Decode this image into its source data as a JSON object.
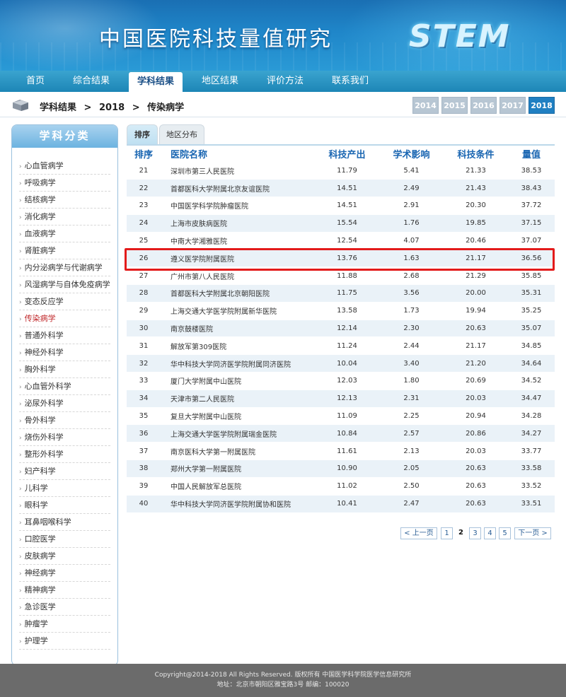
{
  "header": {
    "site_title": "中国医院科技量值研究",
    "logo_text": "STEM"
  },
  "nav": [
    {
      "label": "首页"
    },
    {
      "label": "综合结果"
    },
    {
      "label": "学科结果",
      "active": true
    },
    {
      "label": "地区结果"
    },
    {
      "label": "评价方法"
    },
    {
      "label": "联系我们"
    }
  ],
  "breadcrumb": [
    "学科结果",
    ">",
    "2018",
    ">",
    "传染病学"
  ],
  "years": [
    {
      "label": "2014"
    },
    {
      "label": "2015"
    },
    {
      "label": "2016"
    },
    {
      "label": "2017"
    },
    {
      "label": "2018",
      "active": true
    }
  ],
  "sidebar": {
    "title": "学科分类",
    "items": [
      "心血管病学",
      "呼吸病学",
      "结核病学",
      "消化病学",
      "血液病学",
      "肾脏病学",
      "内分泌病学与代谢病学",
      "风湿病学与自体免疫病学",
      "变态反应学",
      "传染病学",
      "普通外科学",
      "神经外科学",
      "胸外科学",
      "心血管外科学",
      "泌尿外科学",
      "骨外科学",
      "烧伤外科学",
      "整形外科学",
      "妇产科学",
      "儿科学",
      "眼科学",
      "耳鼻咽喉科学",
      "口腔医学",
      "皮肤病学",
      "神经病学",
      "精神病学",
      "急诊医学",
      "肿瘤学",
      "护理学"
    ],
    "active_index": 9
  },
  "tabs": [
    {
      "label": "排序",
      "active": true
    },
    {
      "label": "地区分布"
    }
  ],
  "table": {
    "headers": [
      "排序",
      "医院名称",
      "科技产出",
      "学术影响",
      "科技条件",
      "量值"
    ],
    "rows": [
      [
        "21",
        "深圳市第三人民医院",
        "11.79",
        "5.41",
        "21.33",
        "38.53"
      ],
      [
        "22",
        "首都医科大学附属北京友谊医院",
        "14.51",
        "2.49",
        "21.43",
        "38.43"
      ],
      [
        "23",
        "中国医学科学院肿瘤医院",
        "14.51",
        "2.91",
        "20.30",
        "37.72"
      ],
      [
        "24",
        "上海市皮肤病医院",
        "15.54",
        "1.76",
        "19.85",
        "37.15"
      ],
      [
        "25",
        "中南大学湘雅医院",
        "12.54",
        "4.07",
        "20.46",
        "37.07"
      ],
      [
        "26",
        "遵义医学院附属医院",
        "13.76",
        "1.63",
        "21.17",
        "36.56"
      ],
      [
        "27",
        "广州市第八人民医院",
        "11.88",
        "2.68",
        "21.29",
        "35.85"
      ],
      [
        "28",
        "首都医科大学附属北京朝阳医院",
        "11.75",
        "3.56",
        "20.00",
        "35.31"
      ],
      [
        "29",
        "上海交通大学医学院附属新华医院",
        "13.58",
        "1.73",
        "19.94",
        "35.25"
      ],
      [
        "30",
        "南京鼓楼医院",
        "12.14",
        "2.30",
        "20.63",
        "35.07"
      ],
      [
        "31",
        "解放军第309医院",
        "11.24",
        "2.44",
        "21.17",
        "34.85"
      ],
      [
        "32",
        "华中科技大学同济医学院附属同济医院",
        "10.04",
        "3.40",
        "21.20",
        "34.64"
      ],
      [
        "33",
        "厦门大学附属中山医院",
        "12.03",
        "1.80",
        "20.69",
        "34.52"
      ],
      [
        "34",
        "天津市第二人民医院",
        "12.13",
        "2.31",
        "20.03",
        "34.47"
      ],
      [
        "35",
        "复旦大学附属中山医院",
        "11.09",
        "2.25",
        "20.94",
        "34.28"
      ],
      [
        "36",
        "上海交通大学医学院附属瑞金医院",
        "10.84",
        "2.57",
        "20.86",
        "34.27"
      ],
      [
        "37",
        "南京医科大学第一附属医院",
        "11.61",
        "2.13",
        "20.03",
        "33.77"
      ],
      [
        "38",
        "郑州大学第一附属医院",
        "10.90",
        "2.05",
        "20.63",
        "33.58"
      ],
      [
        "39",
        "中国人民解放军总医院",
        "11.02",
        "2.50",
        "20.63",
        "33.52"
      ],
      [
        "40",
        "华中科技大学同济医学院附属协和医院",
        "10.41",
        "2.47",
        "20.63",
        "33.51"
      ]
    ],
    "highlighted_rank": "26"
  },
  "pagination": {
    "prev": "< 上一页",
    "pages": [
      "1",
      "2",
      "3",
      "4",
      "5"
    ],
    "current": "2",
    "next": "下一页 >"
  },
  "footer": {
    "line1": "Copyright@2014-2018 All Rights Reserved. 版权所有 中国医学科学院医学信息研究所",
    "line2": "地址：北京市朝阳区雅宝路3号 邮编：100020"
  },
  "colors": {
    "accent": "#1f7fc2",
    "highlight_border": "#e31b1b",
    "active_sidebar": "#c0282b",
    "row_alt": "#eaf2f8"
  }
}
